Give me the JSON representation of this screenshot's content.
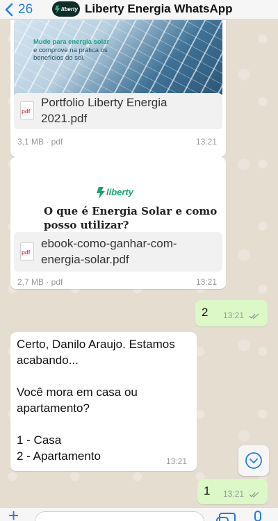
{
  "header": {
    "back_count": "26",
    "title": "Liberty Energia WhatsApp",
    "avatar_logo_text": "liberty"
  },
  "messages": [
    {
      "type": "document",
      "thumbnail_headline": "Mude para energia solar",
      "thumbnail_subtext": "e comprove na prática os benefícios do sol.",
      "file_icon": "pdf",
      "filename": "Portfolio Liberty Energia 2021.pdf",
      "meta": "3,1 MB · pdf",
      "time": "13:21"
    },
    {
      "type": "document",
      "thumbnail_logo": "liberty",
      "thumbnail_heading": "O que é Energia Solar e como posso utilizar?",
      "file_icon": "pdf",
      "filename": "ebook-como-ganhar-com-energia-solar.pdf",
      "meta": "2,7 MB · pdf",
      "time": "13:21"
    },
    {
      "type": "text",
      "direction": "outgoing",
      "text": "2",
      "time": "13:21",
      "status": "read"
    },
    {
      "type": "text",
      "direction": "incoming",
      "text": "Certo, Danilo Araujo. Estamos acabando...\n\nVocê mora em casa ou apartamento?\n\n1 - Casa\n2 - Apartamento",
      "time": "13:21"
    },
    {
      "type": "text",
      "direction": "outgoing",
      "text": "1",
      "time": "13:21",
      "status": "read"
    }
  ],
  "icons": {
    "back": "chevron-left-icon",
    "scroll_down": "chevron-down-circle-icon",
    "attach": "plus-icon",
    "sticker": "sticker-icon",
    "camera": "camera-icon",
    "mic": "microphone-icon"
  },
  "colors": {
    "accent": "#1e7cf2",
    "outgoing_bubble": "#dcf8c6",
    "incoming_bubble": "#ffffff",
    "read_ticks": "#9a9a9a",
    "brand_green": "#1c9e8c"
  }
}
